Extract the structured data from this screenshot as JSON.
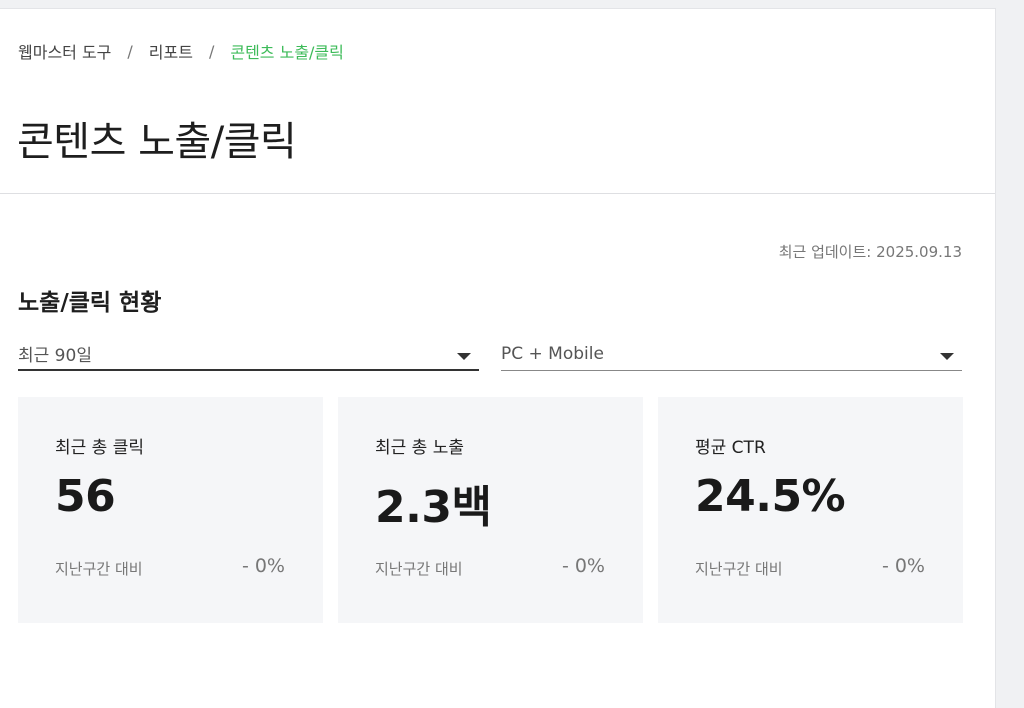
{
  "breadcrumb": {
    "items": [
      "웹마스터 도구",
      "리포트"
    ],
    "current": "콘텐츠 노출/클릭",
    "separator": "/"
  },
  "page": {
    "title": "콘텐츠 노출/클릭",
    "updated": "최근 업데이트: 2025.09.13"
  },
  "section": {
    "title": "노출/클릭 현황"
  },
  "filters": {
    "period": "최근 90일",
    "device": "PC + Mobile"
  },
  "cards": [
    {
      "label": "최근 총 클릭",
      "value": "56",
      "compare": "지난구간 대비",
      "delta": "- 0%"
    },
    {
      "label": "최근 총 노출",
      "value": "2.3백",
      "compare": "지난구간 대비",
      "delta": "- 0%"
    },
    {
      "label": "평균 CTR",
      "value": "24.5%",
      "compare": "지난구간 대비",
      "delta": "- 0%"
    }
  ],
  "colors": {
    "accent": "#3dbb59",
    "card_bg": "#f5f6f8"
  }
}
